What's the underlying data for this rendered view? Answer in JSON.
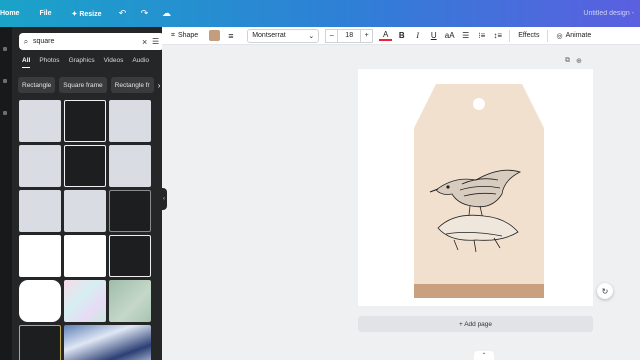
{
  "topbar": {
    "home": "Home",
    "file": "File",
    "resize": "✦ Resize",
    "undo_icon": "undo-icon",
    "redo_icon": "redo-icon",
    "cloud_icon": "cloud-icon",
    "doc_title": "Untitled design -"
  },
  "search": {
    "value": "square",
    "icon": "search-icon"
  },
  "tabs": [
    "All",
    "Photos",
    "Graphics",
    "Videos",
    "Audio"
  ],
  "chips": [
    "Rectangle",
    "Square frame",
    "Rectangle fr"
  ],
  "toolbar": {
    "shape_label": "Shape",
    "fill_color": "#c49d7d",
    "font": "Montserrat",
    "font_size": "18",
    "minus": "–",
    "plus": "+",
    "bold": "B",
    "italic": "I",
    "underline": "U",
    "case": "aA",
    "effects": "Effects",
    "animate": "Animate"
  },
  "canvas": {
    "add_page": "+ Add page",
    "tag_color": "#f2e0cf",
    "tag_band_color": "#c9a17e"
  },
  "colors": {
    "accent_start": "#1aa3c9",
    "accent_end": "#5b5fe0",
    "panel_bg": "#252627"
  }
}
